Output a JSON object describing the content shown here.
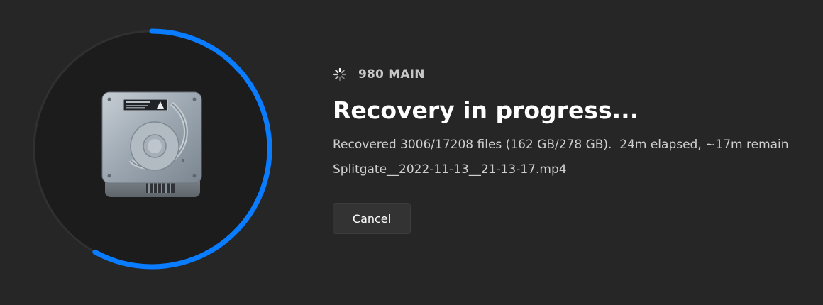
{
  "device": {
    "name": "980 MAIN",
    "status_icon": "spinner-icon",
    "drive_icon": "hard-drive-icon"
  },
  "recovery": {
    "title": "Recovery in progress...",
    "status_line": "Recovered 3006/17208 files (162 GB/278 GB).  24m elapsed, ~17m remain",
    "current_file": "Splitgate__2022-11-13__21-13-17.mp4",
    "progress_fraction": 0.58
  },
  "actions": {
    "cancel_label": "Cancel"
  },
  "colors": {
    "accent": "#0a7cff",
    "track": "#323232",
    "background": "#262626",
    "inner_circle": "#1c1c1c"
  }
}
